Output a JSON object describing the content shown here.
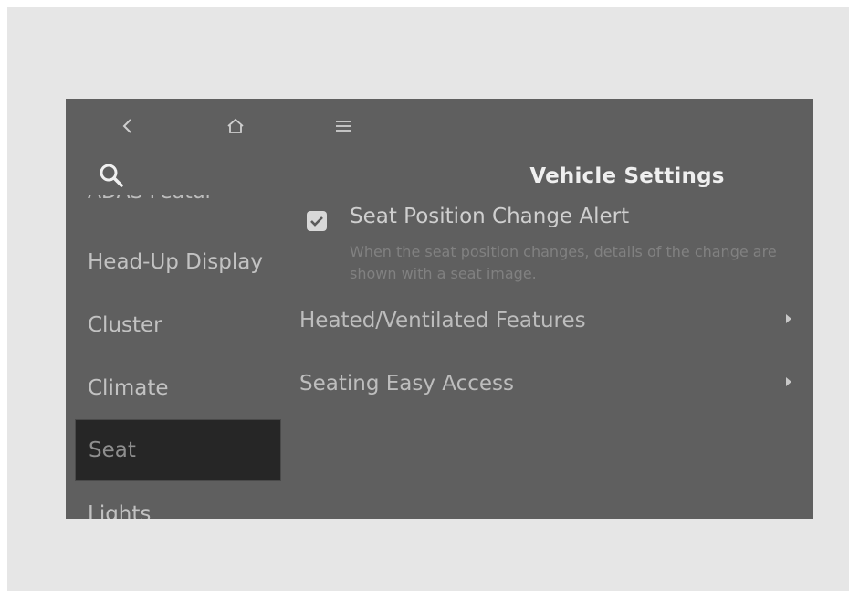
{
  "header": {
    "title": "Vehicle Settings"
  },
  "toolbar": {
    "back_icon": "chevron-left-icon",
    "home_icon": "home-icon",
    "menu_icon": "menu-icon",
    "search_icon": "search-icon"
  },
  "sidebar": {
    "partial_top_item": "ADAS Features",
    "items": [
      {
        "label": "Head-Up Display",
        "selected": false
      },
      {
        "label": "Cluster",
        "selected": false
      },
      {
        "label": "Climate",
        "selected": false
      },
      {
        "label": "Seat",
        "selected": true
      },
      {
        "label": "Lights",
        "selected": false
      }
    ]
  },
  "content": {
    "seat_alert": {
      "label": "Seat Position Change Alert",
      "description": "When the seat position changes, details of the change are shown with a seat image.",
      "checked": true
    },
    "menu_items": [
      {
        "label": "Heated/Ventilated Features",
        "icon": "chevron-right-icon"
      },
      {
        "label": "Seating Easy Access",
        "icon": "chevron-right-icon"
      }
    ]
  },
  "colors": {
    "screen_background": "#5f5f5f",
    "selected_background": "#262626",
    "outer_background": "#e6e6e6"
  }
}
